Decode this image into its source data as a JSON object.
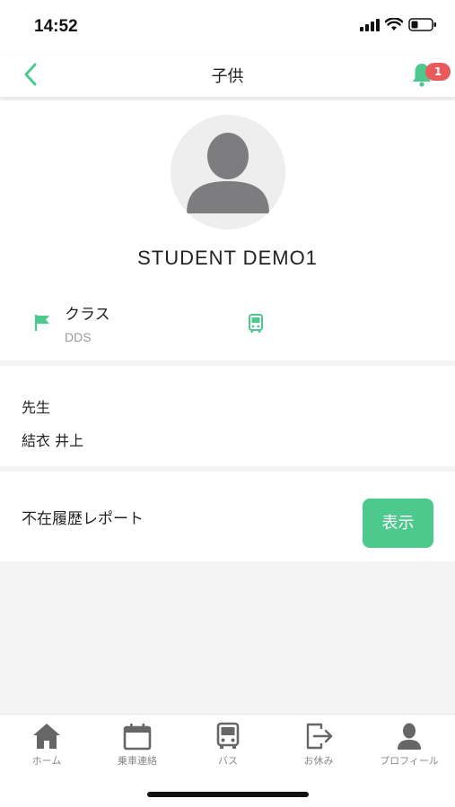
{
  "status_bar": {
    "time": "14:52"
  },
  "nav": {
    "title": "子供",
    "notification_count": "1"
  },
  "profile": {
    "student_name": "STUDENT DEMO1",
    "class_label": "クラス",
    "class_value": "DDS"
  },
  "teacher": {
    "heading": "先生",
    "name": "結衣 井上"
  },
  "report": {
    "label": "不在履歴レポート",
    "button_label": "表示"
  },
  "tabs": [
    {
      "label": "ホーム",
      "icon": "home-icon"
    },
    {
      "label": "乗車連絡",
      "icon": "calendar-icon"
    },
    {
      "label": "バス",
      "icon": "bus-icon"
    },
    {
      "label": "お休み",
      "icon": "logout-icon"
    },
    {
      "label": "プロフィール",
      "icon": "person-icon"
    }
  ],
  "colors": {
    "accent": "#4ec98d",
    "badge": "#ea5a5a",
    "tab_icon": "#666666"
  }
}
